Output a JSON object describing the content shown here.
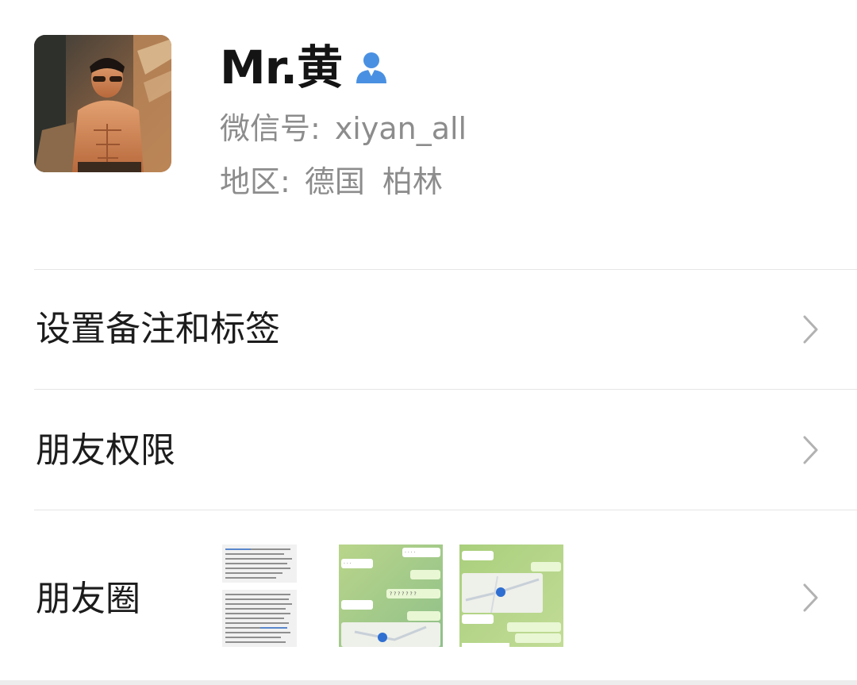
{
  "profile": {
    "name": "Mr.黄",
    "wechat_id_label": "微信号:",
    "wechat_id": "xiyan_all",
    "region_label": "地区:",
    "region_country": "德国",
    "region_city": "柏林",
    "avatar_icon": "profile-photo",
    "gender_icon": "male-user-icon",
    "gender_color": "#4a90e2"
  },
  "menu": {
    "set_remark": "设置备注和标签",
    "friend_permissions": "朋友权限",
    "moments": "朋友圈"
  },
  "colors": {
    "text_primary": "#141414",
    "text_secondary": "#8c8c8c",
    "divider": "#e6e6e6",
    "chevron": "#b2b2b2"
  }
}
